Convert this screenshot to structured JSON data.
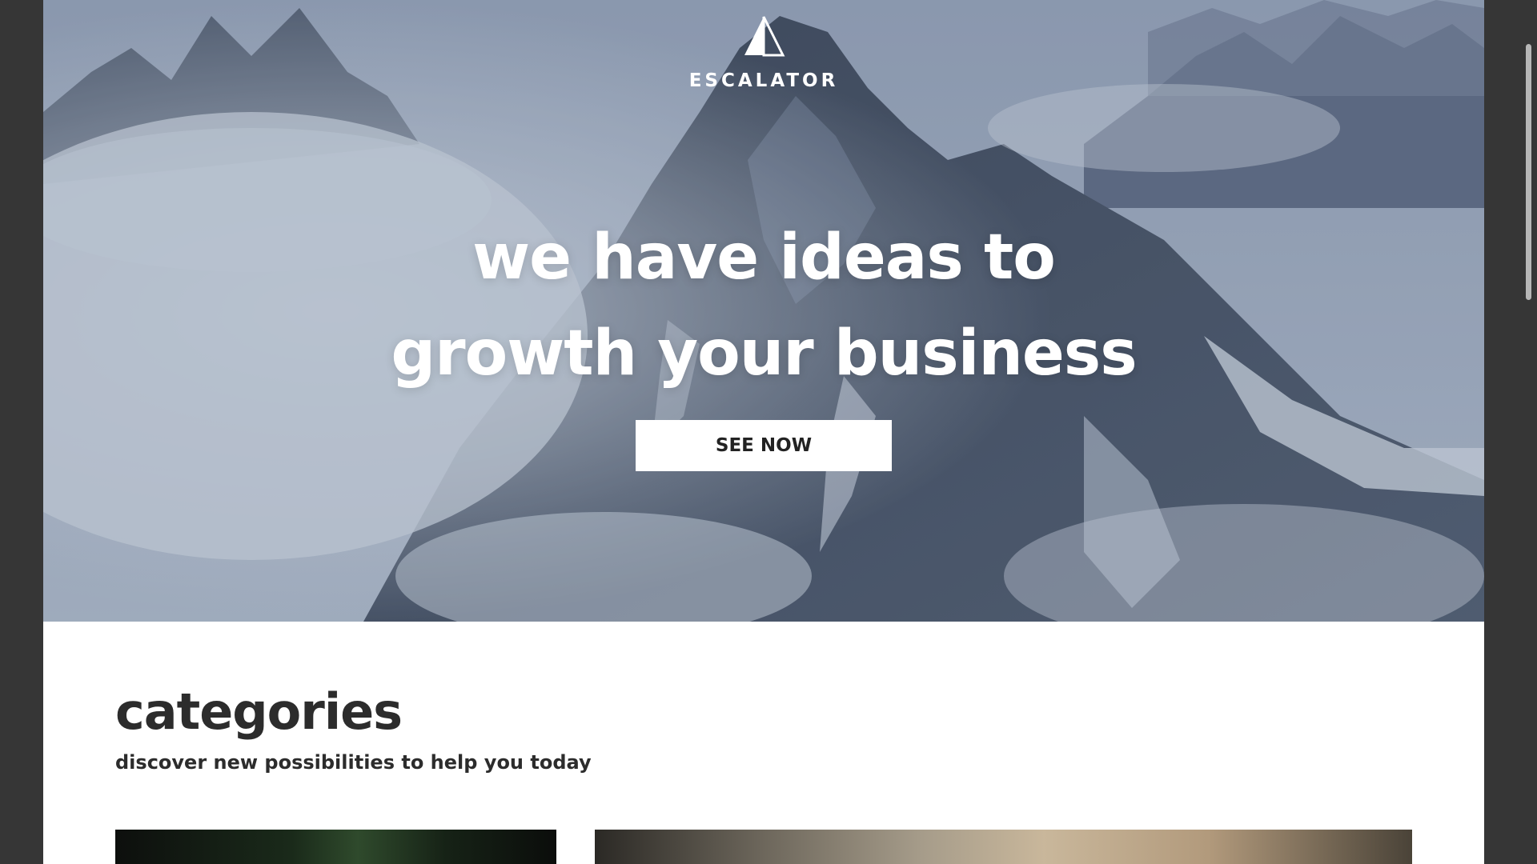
{
  "hero": {
    "brand": "ESCALATOR",
    "headline_line1": "we have ideas to",
    "headline_line2": "growth your business",
    "cta_label": "SEE NOW"
  },
  "categories": {
    "title": "categories",
    "subtitle": "discover new possibilities to help you today"
  },
  "colors": {
    "hero_overlay": "#7f8da4",
    "page_background": "#ffffff",
    "outer_background": "#363636",
    "text_dark": "#2c2c2c",
    "button_background": "#ffffff"
  },
  "icons": {
    "logo": "triangle-logo-icon"
  }
}
